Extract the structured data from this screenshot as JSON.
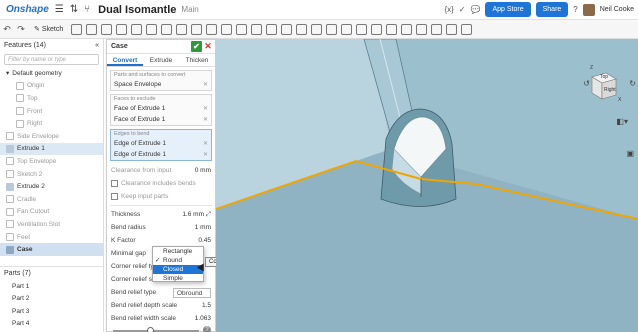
{
  "header": {
    "logo": "Onshape",
    "doc_title": "Dual Isomantle",
    "branch": "Main",
    "braces_icon": "{x}",
    "app_store": "App Store",
    "share": "Share",
    "help": "?",
    "user": "Neil Cooke"
  },
  "toolbar": {
    "sketch_label": "Sketch"
  },
  "features": {
    "heading": "Features (14)",
    "filter_placeholder": "Filter by name or type",
    "items": [
      {
        "label": "Default geometry"
      },
      {
        "label": "Origin"
      },
      {
        "label": "Top"
      },
      {
        "label": "Front"
      },
      {
        "label": "Right"
      },
      {
        "label": "Side Envelope"
      },
      {
        "label": "Extrude 1"
      },
      {
        "label": "Top Envelope"
      },
      {
        "label": "Sketch 2"
      },
      {
        "label": "Extrude 2"
      },
      {
        "label": "Cradle"
      },
      {
        "label": "Fan Cutout"
      },
      {
        "label": "Ventilation Slot"
      },
      {
        "label": "Feet"
      },
      {
        "label": "Case"
      }
    ],
    "parts_heading": "Parts (7)",
    "parts": [
      "Part 1",
      "Part 2",
      "Part 3",
      "Part 4"
    ]
  },
  "dialog": {
    "title": "Case",
    "tabs": [
      "Convert",
      "Extrude",
      "Thicken"
    ],
    "parts_caption": "Parts and surfaces to convert",
    "parts_value": "Space Envelope",
    "faces_caption": "Faces to exclude",
    "faces": [
      "Face of Extrude 1",
      "Face of Extrude 1"
    ],
    "edges_caption": "Edges to bend",
    "edges": [
      "Edge of Extrude 1",
      "Edge of Extrude 1"
    ],
    "clearance_label": "Clearance from input",
    "clearance_value": "0 mm",
    "clearance_bends": "Clearance includes bends",
    "keep_parts": "Keep input parts",
    "thickness_label": "Thickness",
    "thickness_value": "1.6 mm",
    "bend_radius_label": "Bend radius",
    "bend_radius_value": "1 mm",
    "kfactor_label": "K Factor",
    "kfactor_value": "0.45",
    "min_gap_label": "Minimal gap",
    "corner_relief_type_label": "Corner relief type",
    "corner_relief_scale_label": "Corner relief scale",
    "bend_relief_type_label": "Bend relief type",
    "bend_relief_type_value": "Obround",
    "bend_depth_label": "Bend relief depth scale",
    "bend_depth_value": "1.5",
    "bend_width_label": "Bend relief width scale",
    "bend_width_value": "1.063",
    "help": "?"
  },
  "dropdown": {
    "options": [
      "Rectangle",
      "Round",
      "Closed",
      "Simple"
    ],
    "checked": "✓",
    "tooltip": "Corner relief type"
  },
  "viewcube": {
    "right": "Right",
    "top": "Top",
    "z": "Z",
    "x": "X"
  },
  "colors": {
    "accent": "#1f74d8",
    "ok": "#2e9b3a",
    "edge_highlight": "#f0a500",
    "viewport_bg": "#a7c9d6"
  }
}
